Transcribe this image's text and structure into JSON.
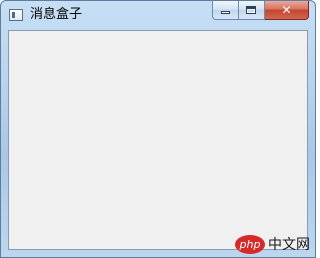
{
  "window": {
    "title": "消息盒子",
    "close_glyph": "✕",
    "icons": {
      "app": "app-window-icon",
      "minimize": "minimize-icon",
      "maximize": "maximize-icon",
      "close": "close-icon"
    }
  },
  "watermark": {
    "logo_text": "php",
    "site_text": "中文网"
  },
  "colors": {
    "frame": "#b9d4ee",
    "client_background": "#f0f0f0",
    "close_button": "#c4452e",
    "watermark_logo": "#d62a2a"
  }
}
